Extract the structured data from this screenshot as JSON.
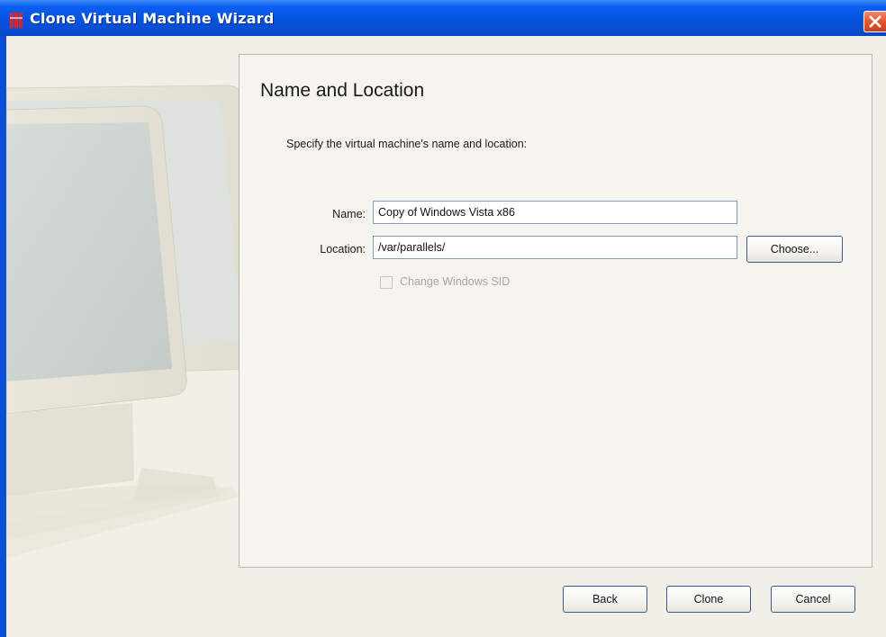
{
  "window": {
    "title": "Clone Virtual Machine Wizard",
    "close_icon": "close-icon",
    "app_icon": "parallels-app-icon"
  },
  "panel": {
    "heading": "Name and Location",
    "subtitle": "Specify the virtual machine's name and location:"
  },
  "form": {
    "name_label": "Name:",
    "name_value": "Copy of Windows Vista x86",
    "location_label": "Location:",
    "location_value": "/var/parallels/",
    "choose_label": "Choose...",
    "sid_label": "Change Windows SID",
    "sid_checked": false,
    "sid_enabled": false
  },
  "footer": {
    "back_label": "Back",
    "clone_label": "Clone",
    "cancel_label": "Cancel"
  },
  "colors": {
    "titlebar": "#0552e0",
    "client": "#f2efe6",
    "close": "#e2582f"
  }
}
